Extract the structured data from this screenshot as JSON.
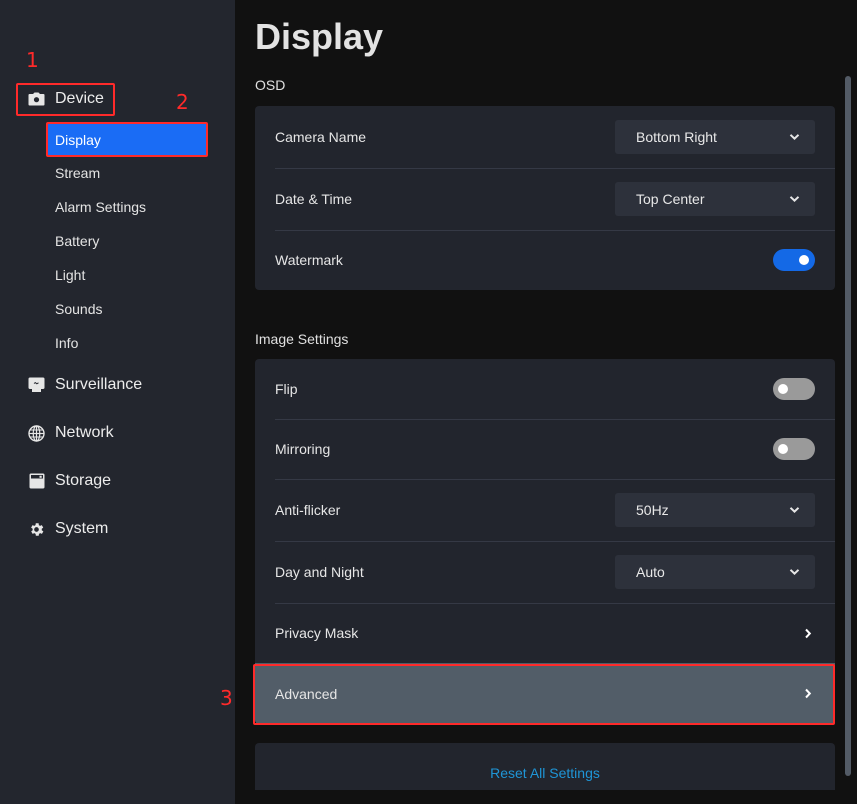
{
  "sidebar": {
    "groups": [
      {
        "label": "Device",
        "icon": "camera-icon"
      },
      {
        "label": "Surveillance",
        "icon": "monitor-icon"
      },
      {
        "label": "Network",
        "icon": "globe-icon"
      },
      {
        "label": "Storage",
        "icon": "storage-icon"
      },
      {
        "label": "System",
        "icon": "gear-icon"
      }
    ],
    "device_items": [
      {
        "label": "Display",
        "active": true
      },
      {
        "label": "Stream"
      },
      {
        "label": "Alarm Settings"
      },
      {
        "label": "Battery"
      },
      {
        "label": "Light"
      },
      {
        "label": "Sounds"
      },
      {
        "label": "Info"
      }
    ]
  },
  "annotations": {
    "n1": "1",
    "n2": "2",
    "n3": "3",
    "color": "#ff2a2a"
  },
  "main": {
    "title": "Display",
    "osd": {
      "label": "OSD",
      "camera_name": {
        "label": "Camera Name",
        "value": "Bottom Right"
      },
      "date_time": {
        "label": "Date & Time",
        "value": "Top Center"
      },
      "watermark": {
        "label": "Watermark",
        "on": true
      }
    },
    "image_settings": {
      "label": "Image Settings",
      "flip": {
        "label": "Flip",
        "on": false
      },
      "mirroring": {
        "label": "Mirroring",
        "on": false
      },
      "anti_flicker": {
        "label": "Anti-flicker",
        "value": "50Hz"
      },
      "day_night": {
        "label": "Day and Night",
        "value": "Auto"
      },
      "privacy_mask": {
        "label": "Privacy Mask"
      },
      "advanced": {
        "label": "Advanced"
      }
    },
    "reset_label": "Reset All Settings"
  },
  "colors": {
    "accent": "#1a6cf5",
    "toggle_on": "#1469e6",
    "link": "#1f95d6",
    "highlight_row": "#525d68"
  }
}
